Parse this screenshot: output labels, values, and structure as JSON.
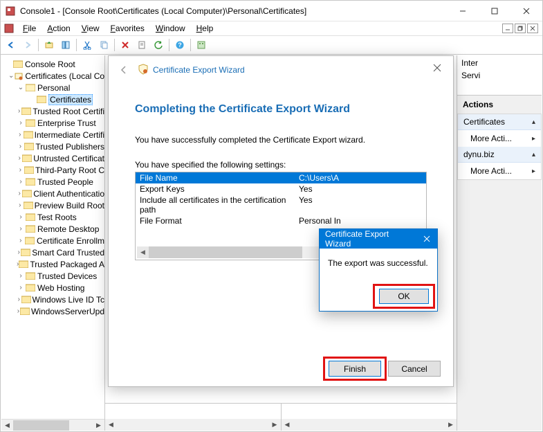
{
  "titlebar": {
    "text": "Console1 - [Console Root\\Certificates (Local Computer)\\Personal\\Certificates]"
  },
  "menu": {
    "file": "File",
    "action": "Action",
    "view": "View",
    "favorites": "Favorites",
    "window": "Window",
    "help": "Help"
  },
  "tree": {
    "root": "Console Root",
    "certs_local": "Certificates (Local Com",
    "personal": "Personal",
    "certificates": "Certificates",
    "items": [
      "Trusted Root Certifi",
      "Enterprise Trust",
      "Intermediate Certifi",
      "Trusted Publishers",
      "Untrusted Certificat",
      "Third-Party Root C",
      "Trusted People",
      "Client Authenticatio",
      "Preview Build Root",
      "Test Roots",
      "Remote Desktop",
      "Certificate Enrollm",
      "Smart Card Trusted",
      "Trusted Packaged A",
      "Trusted Devices",
      "Web Hosting",
      "Windows Live ID Tc",
      "WindowsServerUpd"
    ]
  },
  "right_top": {
    "col1": "Inter",
    "col2": "Servi"
  },
  "actions": {
    "header": "Actions",
    "group1": "Certificates",
    "more1": "More Acti...",
    "group2": "dynu.biz",
    "more2": "More Acti..."
  },
  "wizard": {
    "title": "Certificate Export Wizard",
    "heading": "Completing the Certificate Export Wizard",
    "para": "You have successfully completed the Certificate Export wizard.",
    "settings_label": "You have specified the following settings:",
    "rows": [
      {
        "k": "File Name",
        "v": "C:\\Users\\A"
      },
      {
        "k": "Export Keys",
        "v": "Yes"
      },
      {
        "k": "Include all certificates in the certification path",
        "v": "Yes"
      },
      {
        "k": "File Format",
        "v": "Personal In"
      }
    ],
    "finish": "Finish",
    "cancel": "Cancel"
  },
  "popup": {
    "title": "Certificate Export Wizard",
    "message": "The export was successful.",
    "ok": "OK"
  }
}
